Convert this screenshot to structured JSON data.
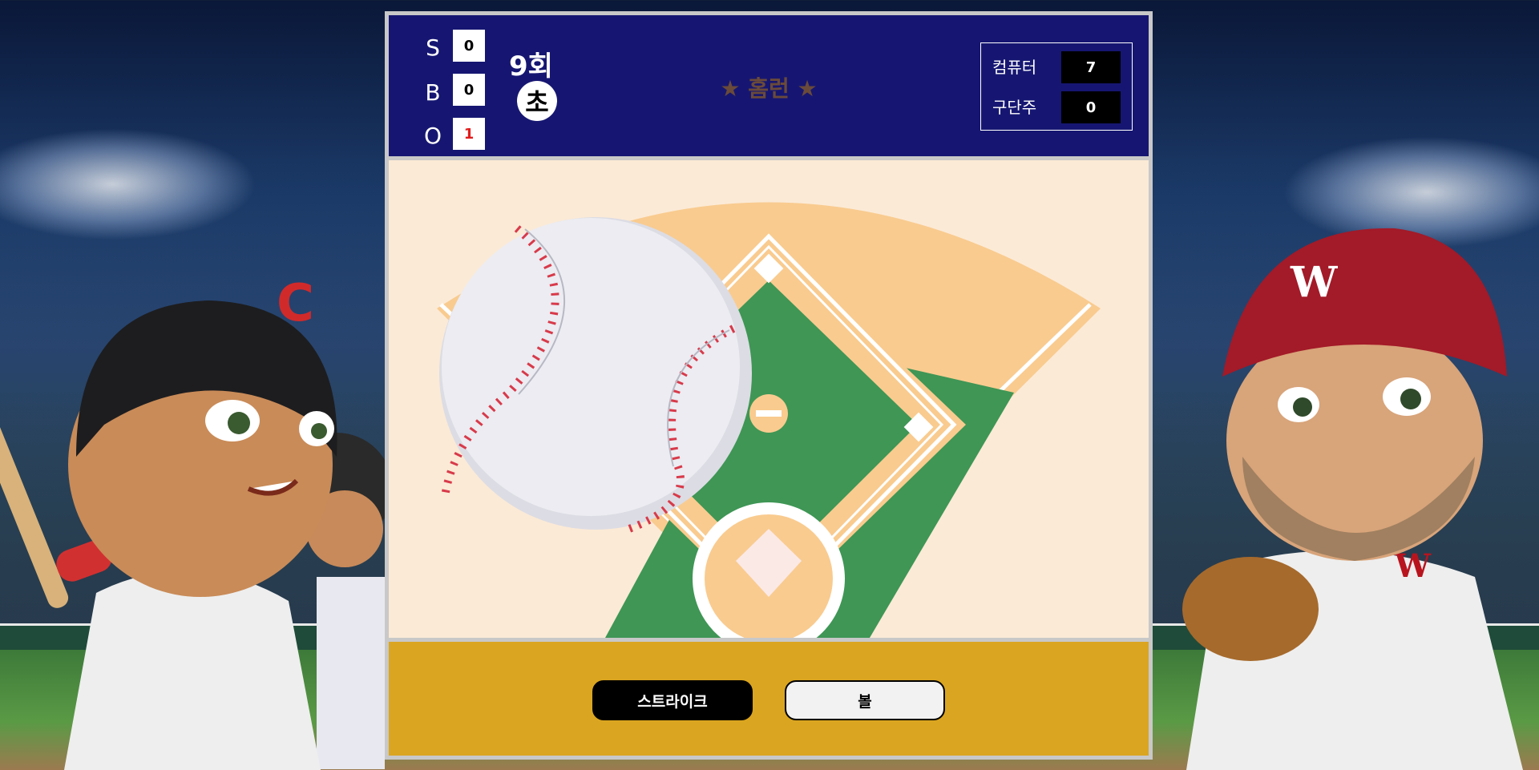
{
  "colors": {
    "scoreboard": "#161672",
    "field_background": "#fbead6",
    "infield_dirt": "#f9cb8f",
    "grass": "#3f9655",
    "controls_bar": "#daa520",
    "out_count": "#e21c1c"
  },
  "scoreboard": {
    "counts": [
      {
        "letter": "S",
        "value": "0"
      },
      {
        "letter": "B",
        "value": "0"
      },
      {
        "letter": "O",
        "value": "1"
      }
    ],
    "inning": "9회",
    "half": "초",
    "event_text": "★ 홈런 ★",
    "scores": [
      {
        "label": "컴퓨터",
        "value": "7"
      },
      {
        "label": "구단주",
        "value": "0"
      }
    ]
  },
  "buttons": {
    "strike": "스트라이크",
    "ball": "볼"
  },
  "background": {
    "left_helmet_letter": "C",
    "right_cap_letter": "W",
    "jersey_letter": "W"
  }
}
